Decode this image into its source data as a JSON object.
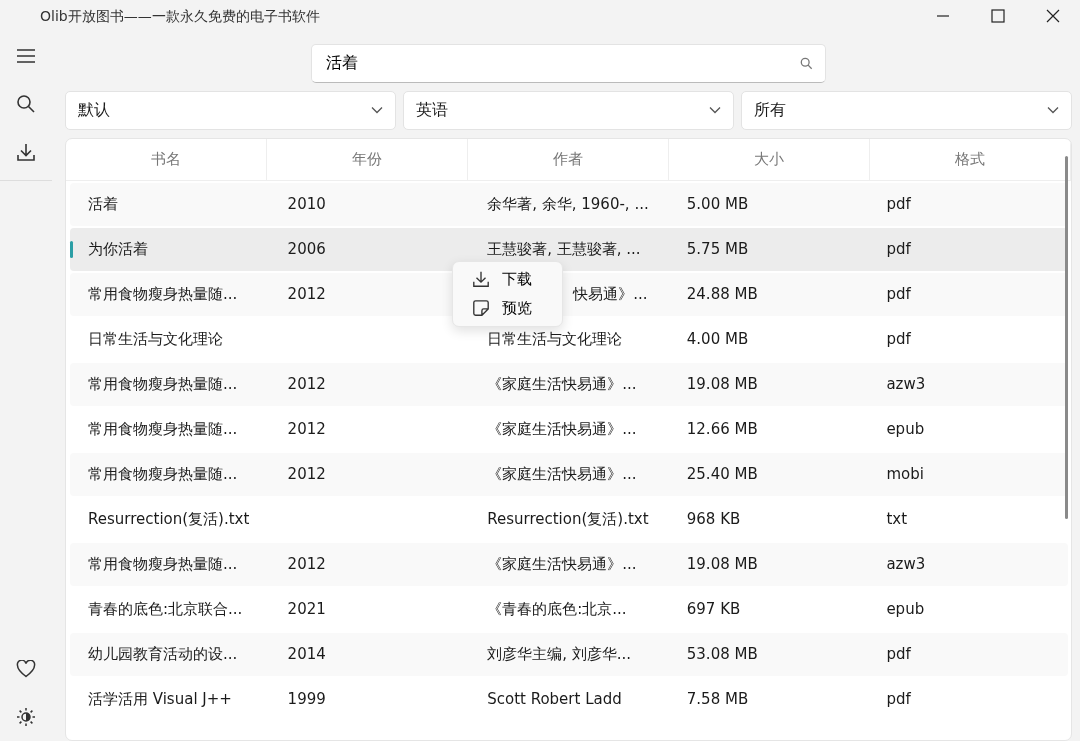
{
  "window": {
    "title": "Olib开放图书——一款永久免费的电子书软件"
  },
  "search": {
    "value": "活着"
  },
  "filters": [
    {
      "value": "默认"
    },
    {
      "value": "英语"
    },
    {
      "value": "所有"
    }
  ],
  "table": {
    "columns": [
      "书名",
      "年份",
      "作者",
      "大小",
      "格式"
    ],
    "rows": [
      {
        "title": "活着",
        "year": "2010",
        "author": "余华著, 余华, 1960-, ...",
        "size": "5.00 MB",
        "format": "pdf",
        "selected": false
      },
      {
        "title": "为你活着",
        "year": "2006",
        "author": "王慧骏著, 王慧骏著, ...",
        "size": "5.75 MB",
        "format": "pdf",
        "selected": true,
        "context_menu": [
          {
            "kind": "download",
            "label": "下载"
          },
          {
            "kind": "preview",
            "label": "预览"
          }
        ]
      },
      {
        "title": "常用食物瘦身热量随...",
        "year": "2012",
        "author": "快易通》...",
        "size": "24.88 MB",
        "format": "pdf",
        "selected": false
      },
      {
        "title": "日常生活与文化理论",
        "author": "日常生活与文化理论",
        "size": "4.00 MB",
        "format": "pdf",
        "selected": false
      },
      {
        "title": "常用食物瘦身热量随...",
        "year": "2012",
        "author": "《家庭生活快易通》...",
        "size": "19.08 MB",
        "format": "azw3",
        "selected": false
      },
      {
        "title": "常用食物瘦身热量随...",
        "year": "2012",
        "author": "《家庭生活快易通》...",
        "size": "12.66 MB",
        "format": "epub",
        "selected": false
      },
      {
        "title": "常用食物瘦身热量随...",
        "year": "2012",
        "author": "《家庭生活快易通》...",
        "size": "25.40 MB",
        "format": "mobi",
        "selected": false
      },
      {
        "title": "Resurrection(复活).txt",
        "author": "Resurrection(复活).txt",
        "size": "968 KB",
        "format": "txt",
        "selected": false
      },
      {
        "title": "常用食物瘦身热量随...",
        "year": "2012",
        "author": "《家庭生活快易通》...",
        "size": "19.08 MB",
        "format": "azw3",
        "selected": false
      },
      {
        "title": "青春的底色:北京联合...",
        "year": "2021",
        "author": "《青春的底色:北京...",
        "size": "697 KB",
        "format": "epub",
        "selected": false
      },
      {
        "title": "幼儿园教育活动的设...",
        "year": "2014",
        "author": "刘彦华主编, 刘彦华...",
        "size": "53.08 MB",
        "format": "pdf",
        "selected": false
      },
      {
        "title": "活学活用 Visual J++",
        "year": "1999",
        "author": "Scott Robert Ladd",
        "size": "7.58 MB",
        "format": "pdf",
        "selected": false
      }
    ]
  }
}
